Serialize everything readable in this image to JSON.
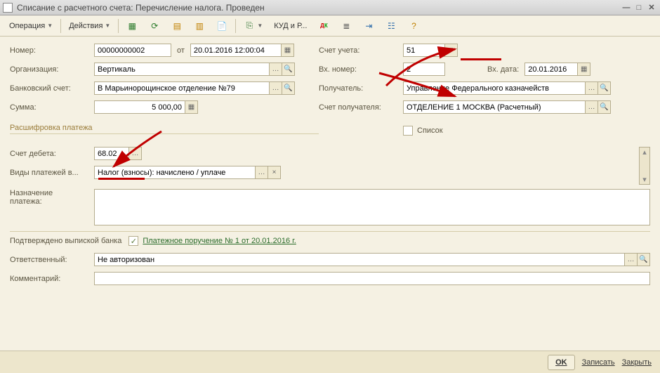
{
  "window": {
    "title": "Списание с расчетного счета: Перечисление налога. Проведен"
  },
  "toolbar": {
    "operation": "Операция",
    "actions": "Действия",
    "kud": "КУД и Р..."
  },
  "labels": {
    "number": "Номер:",
    "from": "от",
    "org": "Организация:",
    "bank": "Банковский счет:",
    "sum": "Сумма:",
    "account": "Счет учета:",
    "inNumber": "Вх. номер:",
    "inDate": "Вх. дата:",
    "recipient": "Получатель:",
    "recAccount": "Счет получателя:",
    "section": "Расшифровка платежа",
    "list": "Список",
    "debit": "Счет дебета:",
    "payType": "Виды платежей в...",
    "purpose1": "Назначение",
    "purpose2": "платежа:",
    "confirmed": "Подтверждено выпиской банка",
    "responsible": "Ответственный:",
    "comment": "Комментарий:"
  },
  "fields": {
    "number": "00000000002",
    "date": "20.01.2016 12:00:04",
    "org": "Вертикаль",
    "bank": "В Марьинорощинское отделение №79",
    "sum": "5 000,00",
    "account": "51",
    "inNumber": "2",
    "inDate": "20.01.2016",
    "recipient": "Управление Федерального казначейств",
    "recAccount": "ОТДЕЛЕНИЕ 1 МОСКВА (Расчетный)",
    "debit": "68.02",
    "payType": "Налог (взносы): начислено / уплаче",
    "responsible": "Не авторизован",
    "link": "Платежное поручение № 1 от 20.01.2016 г."
  },
  "footer": {
    "ok": "OK",
    "save": "Записать",
    "close": "Закрыть"
  }
}
